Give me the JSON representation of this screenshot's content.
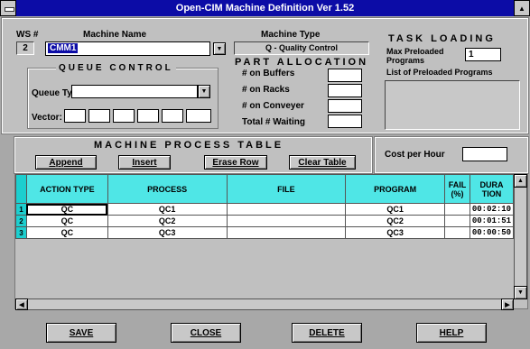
{
  "window": {
    "title": "Open-CIM  Machine Definition  Ver 1.52"
  },
  "ws": {
    "label": "WS #",
    "value": "2"
  },
  "machine_name": {
    "label": "Machine Name",
    "value": "CMM1"
  },
  "machine_type": {
    "label": "Machine Type",
    "value": "Q - Quality Control"
  },
  "task_loading": {
    "title": "TASK LOADING",
    "max_label": "Max Preloaded Programs",
    "max_value": "1",
    "list_label": "List of Preloaded Programs"
  },
  "queue_control": {
    "title": "QUEUE CONTROL",
    "type_label": "Queue Type:",
    "type_value": "",
    "vector_label": "Vector:"
  },
  "part_allocation": {
    "title": "PART ALLOCATION",
    "buffers_label": "# on Buffers",
    "racks_label": "# on Racks",
    "conveyer_label": "# on Conveyer",
    "total_label": "Total # Waiting"
  },
  "process_table": {
    "title": "MACHINE PROCESS TABLE",
    "append_label": "Append",
    "insert_label": "Insert",
    "erase_label": "Erase Row",
    "clear_label": "Clear Table",
    "cost_label": "Cost per Hour",
    "columns": [
      "ACTION TYPE",
      "PROCESS",
      "FILE",
      "PROGRAM",
      "FAIL\n(%)",
      "DURA\nTION"
    ],
    "rows": [
      {
        "n": "1",
        "action": "QC",
        "process": "QC1",
        "file": "",
        "program": "QC1",
        "fail": "",
        "duration": "00:02:10"
      },
      {
        "n": "2",
        "action": "QC",
        "process": "QC2",
        "file": "",
        "program": "QC2",
        "fail": "",
        "duration": "00:01:51"
      },
      {
        "n": "3",
        "action": "QC",
        "process": "QC3",
        "file": "",
        "program": "QC3",
        "fail": "",
        "duration": "00:00:50"
      }
    ]
  },
  "footer": {
    "save": "SAVE",
    "close": "CLOSE",
    "delete": "DELETE",
    "help": "HELP"
  }
}
